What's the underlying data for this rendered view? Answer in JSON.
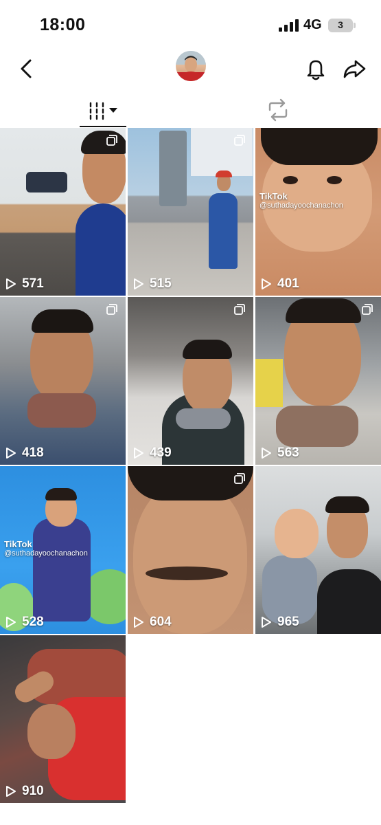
{
  "status_bar": {
    "time": "18:00",
    "network": "4G",
    "battery": "3"
  },
  "nav": {
    "back_icon": "chevron-left-icon",
    "bell_icon": "bell-icon",
    "share_icon": "share-arrow-icon"
  },
  "tabs": [
    {
      "icon": "videos-grid-icon",
      "selected": true
    },
    {
      "icon": "repost-icon",
      "selected": false
    }
  ],
  "videos": [
    {
      "views": "571",
      "multi": true
    },
    {
      "views": "515",
      "multi": true
    },
    {
      "views": "401",
      "multi": false,
      "watermark": "TikTok",
      "handle": "@suthadayoochanachon"
    },
    {
      "views": "418",
      "multi": true
    },
    {
      "views": "439",
      "multi": true
    },
    {
      "views": "563",
      "multi": true
    },
    {
      "views": "528",
      "multi": false,
      "watermark": "TikTok",
      "handle": "@suthadayoochanachon"
    },
    {
      "views": "604",
      "multi": true
    },
    {
      "views": "965",
      "multi": false
    },
    {
      "views": "910",
      "multi": false
    }
  ],
  "colors": {
    "accent": "#111111",
    "background": "#ffffff"
  }
}
